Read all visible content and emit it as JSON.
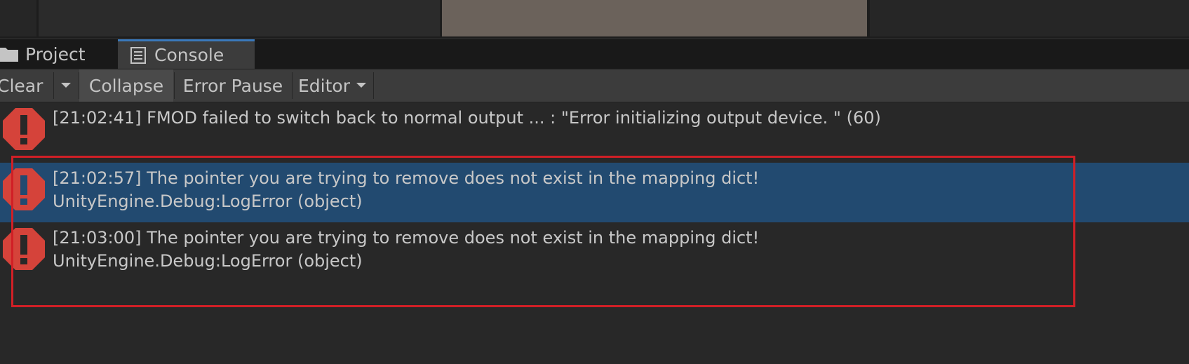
{
  "tabs": {
    "project_label": "Project",
    "console_label": "Console"
  },
  "toolbar": {
    "clear_label": "Clear",
    "collapse_label": "Collapse",
    "error_pause_label": "Error Pause",
    "editor_label": "Editor"
  },
  "log": {
    "entries": [
      {
        "message": "[21:02:41] FMOD failed to switch back to normal output ... : \"Error initializing output device. \" (60)",
        "detail": "",
        "level": "error",
        "selected": false
      },
      {
        "message": "[21:02:57] The pointer you are trying to remove does not exist in the mapping dict!",
        "detail": "UnityEngine.Debug:LogError (object)",
        "level": "error",
        "selected": true
      },
      {
        "message": "[21:03:00] The pointer you are trying to remove does not exist in the mapping dict!",
        "detail": "UnityEngine.Debug:LogError (object)",
        "level": "error",
        "selected": false
      }
    ]
  },
  "colors": {
    "selection": "#224a70",
    "error_icon": "#d5433a",
    "highlight_border": "#d11f26",
    "tab_accent": "#3a79bb"
  }
}
